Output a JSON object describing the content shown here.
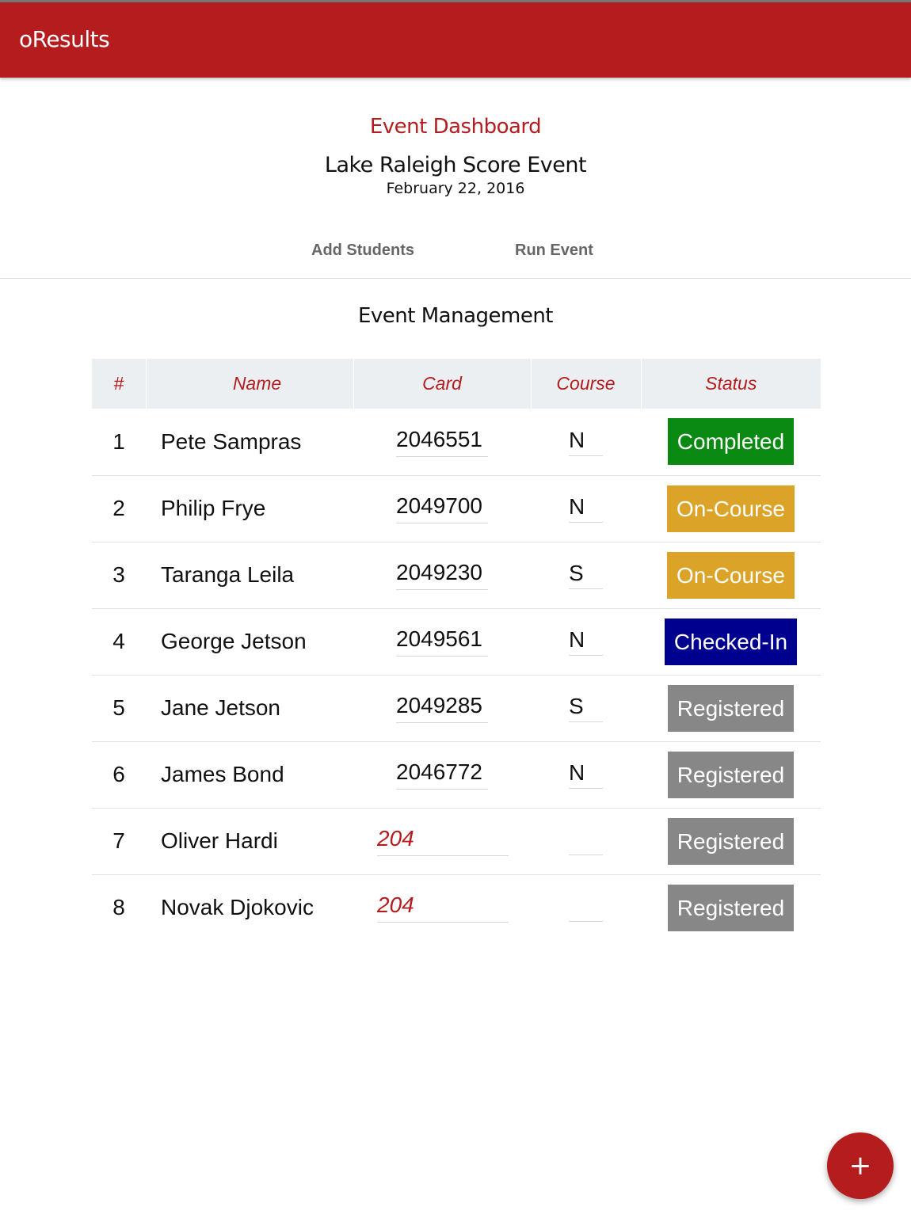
{
  "app": {
    "title": "oResults"
  },
  "header": {
    "title": "Event Dashboard",
    "event_name": "Lake Raleigh Score Event",
    "event_date": "February 22, 2016"
  },
  "tabs": [
    {
      "label": "Add Students"
    },
    {
      "label": "Run Event"
    }
  ],
  "section_title": "Event Management",
  "table": {
    "columns": [
      "#",
      "Name",
      "Card",
      "Course",
      "Status"
    ],
    "rows": [
      {
        "num": "1",
        "name": "Pete Sampras",
        "card": "2046551",
        "course": "N",
        "status": "Completed"
      },
      {
        "num": "2",
        "name": "Philip Frye",
        "card": "2049700",
        "course": "N",
        "status": "On-Course"
      },
      {
        "num": "3",
        "name": "Taranga Leila",
        "card": "2049230",
        "course": "S",
        "status": "On-Course"
      },
      {
        "num": "4",
        "name": "George Jetson",
        "card": "2049561",
        "course": "N",
        "status": "Checked-In"
      },
      {
        "num": "5",
        "name": "Jane Jetson",
        "card": "2049285",
        "course": "S",
        "status": "Registered"
      },
      {
        "num": "6",
        "name": "James Bond",
        "card": "2046772",
        "course": "N",
        "status": "Registered"
      },
      {
        "num": "7",
        "name": "Oliver Hardi",
        "card": "204",
        "course": "",
        "status": "Registered"
      },
      {
        "num": "8",
        "name": "Novak Djokovic",
        "card": "204",
        "course": "",
        "status": "Registered"
      }
    ]
  },
  "status_colors": {
    "Completed": "#0a8a12",
    "On-Course": "#dba428",
    "Checked-In": "#00008f",
    "Registered": "#878787"
  },
  "colors": {
    "accent": "#b41c1e",
    "header_bg": "#eceff1"
  },
  "fab": {
    "icon": "plus-icon",
    "glyph": "+"
  }
}
